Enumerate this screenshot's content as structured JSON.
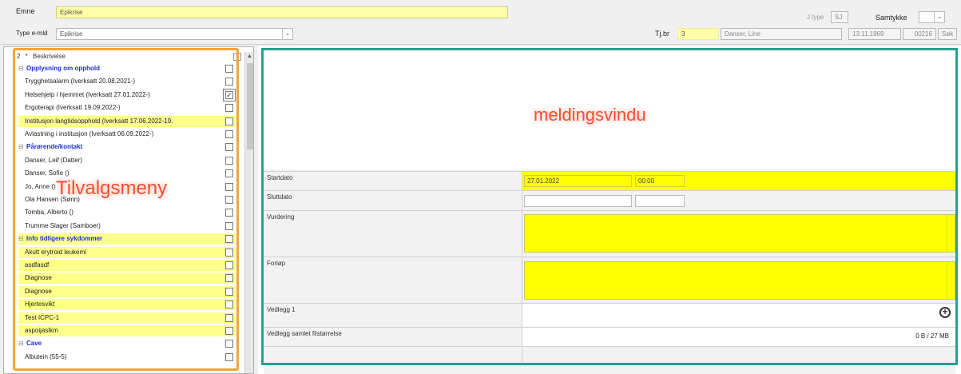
{
  "header": {
    "emne_label": "Emne",
    "emne_value": "Epikrise",
    "type_label": "Type e-mld",
    "type_value": "Epikrise",
    "jtype_label": "J.type",
    "jtype_value": "SJ",
    "samtykke_label": "Samtykke",
    "tjbr_label": "Tj.br",
    "tjbr_value": "3",
    "patient_name": "Danser, Line",
    "birth_date": "13.11.1969",
    "patient_id": "00216",
    "search_label": "Søk"
  },
  "tree": {
    "header_num": "2",
    "header_star": "*",
    "header_label": "Beskrivelse",
    "rows": [
      {
        "label": "Opplysning om opphold",
        "group": true,
        "checked": false
      },
      {
        "label": "Trygghetsalarm (Iverksatt 20.08.2021-)",
        "group": false,
        "checked": false
      },
      {
        "label": "Helsehjelp i hjemmet (Iverksatt 27.01.2022-)",
        "group": false,
        "checked": true
      },
      {
        "label": "Ergoterapi (Iverksatt 19.09.2022-)",
        "group": false,
        "checked": false
      },
      {
        "label": "Institusjon langtidsopphold (Iverksatt 17.06.2022-19.",
        "group": false,
        "checked": false,
        "highlight": true
      },
      {
        "label": "Avlastning i institusjon (Iverksatt 06.09.2022-)",
        "group": false,
        "checked": false
      },
      {
        "label": "Pårørende/kontakt",
        "group": true,
        "checked": false
      },
      {
        "label": "Danser, Leif (Datter)",
        "group": false,
        "checked": false
      },
      {
        "label": "Danser, Sofie ()",
        "group": false,
        "checked": false
      },
      {
        "label": "Jo, Anne ()",
        "group": false,
        "checked": false
      },
      {
        "label": "Ola Hansen (Sønn)",
        "group": false,
        "checked": false
      },
      {
        "label": "Tomba, Alberto ()",
        "group": false,
        "checked": false
      },
      {
        "label": "Trumme Slager (Samboer)",
        "group": false,
        "checked": false
      },
      {
        "label": "Info tidligere sykdommer",
        "group": true,
        "checked": false,
        "highlight": true
      },
      {
        "label": "Akutt erytroid leukemi",
        "group": false,
        "checked": false,
        "highlight": true
      },
      {
        "label": "asdfasdf",
        "group": false,
        "checked": false,
        "highlight": true
      },
      {
        "label": "Diagnose",
        "group": false,
        "checked": false,
        "highlight": true
      },
      {
        "label": "Diagnose",
        "group": false,
        "checked": false,
        "highlight": true
      },
      {
        "label": "Hjertesvikt",
        "group": false,
        "checked": false,
        "highlight": true
      },
      {
        "label": "Test ICPC-1",
        "group": false,
        "checked": false,
        "highlight": true
      },
      {
        "label": "aspoijaslkm",
        "group": false,
        "checked": false,
        "highlight": true
      },
      {
        "label": "Cave",
        "group": true,
        "checked": false
      },
      {
        "label": "Albutein (55-5)",
        "group": false,
        "checked": false
      }
    ]
  },
  "overlays": {
    "left": "Tilvalgsmeny",
    "right": "meldingsvindu"
  },
  "form": {
    "startdato_label": "Startdato",
    "startdato_value": "27.01.2022",
    "starttid_value": "00:00",
    "sluttdato_label": "Sluttdato",
    "vurdering_label": "Vurdering",
    "forlop_label": "Forløp",
    "vedlegg_label": "Vedlegg 1",
    "vedlegg_size_label": "Vedlegg samlet filstørrelse",
    "vedlegg_size_value": "0 B / 27 MB"
  },
  "colors": {
    "highlight_row": "#ffff8c",
    "required_field": "#ffff00",
    "group_text": "#1c2fd6",
    "orange_frame": "#f2a53a",
    "teal_frame": "#2aa090",
    "overlay_text": "#f05030"
  }
}
